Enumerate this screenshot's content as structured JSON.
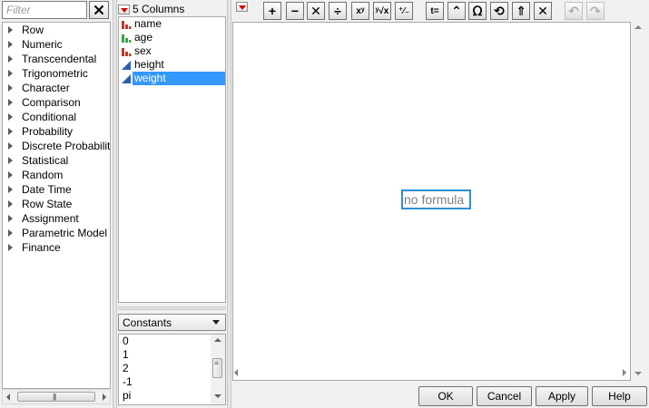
{
  "filter": {
    "placeholder": "Filter"
  },
  "function_categories": [
    "Row",
    "Numeric",
    "Transcendental",
    "Trigonometric",
    "Character",
    "Comparison",
    "Conditional",
    "Probability",
    "Discrete Probability",
    "Statistical",
    "Random",
    "Date Time",
    "Row State",
    "Assignment",
    "Parametric Model",
    "Finance"
  ],
  "columns": {
    "count_label": "5 Columns",
    "items": [
      {
        "name": "name",
        "type": "nominal"
      },
      {
        "name": "age",
        "type": "ordinal"
      },
      {
        "name": "sex",
        "type": "nominal"
      },
      {
        "name": "height",
        "type": "continuous"
      },
      {
        "name": "weight",
        "type": "continuous",
        "selected": true
      }
    ]
  },
  "constants": {
    "selected": "Constants",
    "items": [
      "0",
      "1",
      "2",
      "-1",
      "pi"
    ]
  },
  "toolbar": {
    "buttons": [
      {
        "icon": "plus-icon",
        "glyph": "+"
      },
      {
        "icon": "minus-icon",
        "glyph": "−"
      },
      {
        "icon": "multiply-icon",
        "glyph": "✕"
      },
      {
        "icon": "divide-icon",
        "glyph": "÷"
      },
      {
        "icon": "power-icon",
        "glyph": "xʸ"
      },
      {
        "icon": "root-icon",
        "glyph": "ʸ√x"
      },
      {
        "icon": "plus-minus-icon",
        "glyph": "⁺⁄₋"
      },
      {
        "icon": "assign-icon",
        "glyph": "t="
      },
      {
        "icon": "peel-icon",
        "glyph": "⌃"
      },
      {
        "icon": "local-variable-icon",
        "glyph": "ᘯ"
      },
      {
        "icon": "swap-icon",
        "glyph": "⟲"
      },
      {
        "icon": "unwrap-icon",
        "glyph": "⇑"
      },
      {
        "icon": "delete-icon",
        "glyph": "✕"
      },
      {
        "icon": "undo-icon",
        "glyph": "↶",
        "disabled": true
      },
      {
        "icon": "redo-icon",
        "glyph": "↷",
        "disabled": true
      }
    ]
  },
  "formula": {
    "placeholder_text": "no formula"
  },
  "buttons": {
    "ok": "OK",
    "cancel": "Cancel",
    "apply": "Apply",
    "help": "Help"
  },
  "colors": {
    "selection": "#3399ff",
    "formula_border": "#2d8fd4",
    "nominal_icon": "#c0392b",
    "ordinal_icon": "#3fa04a",
    "continuous_icon": "#2a5db0"
  }
}
